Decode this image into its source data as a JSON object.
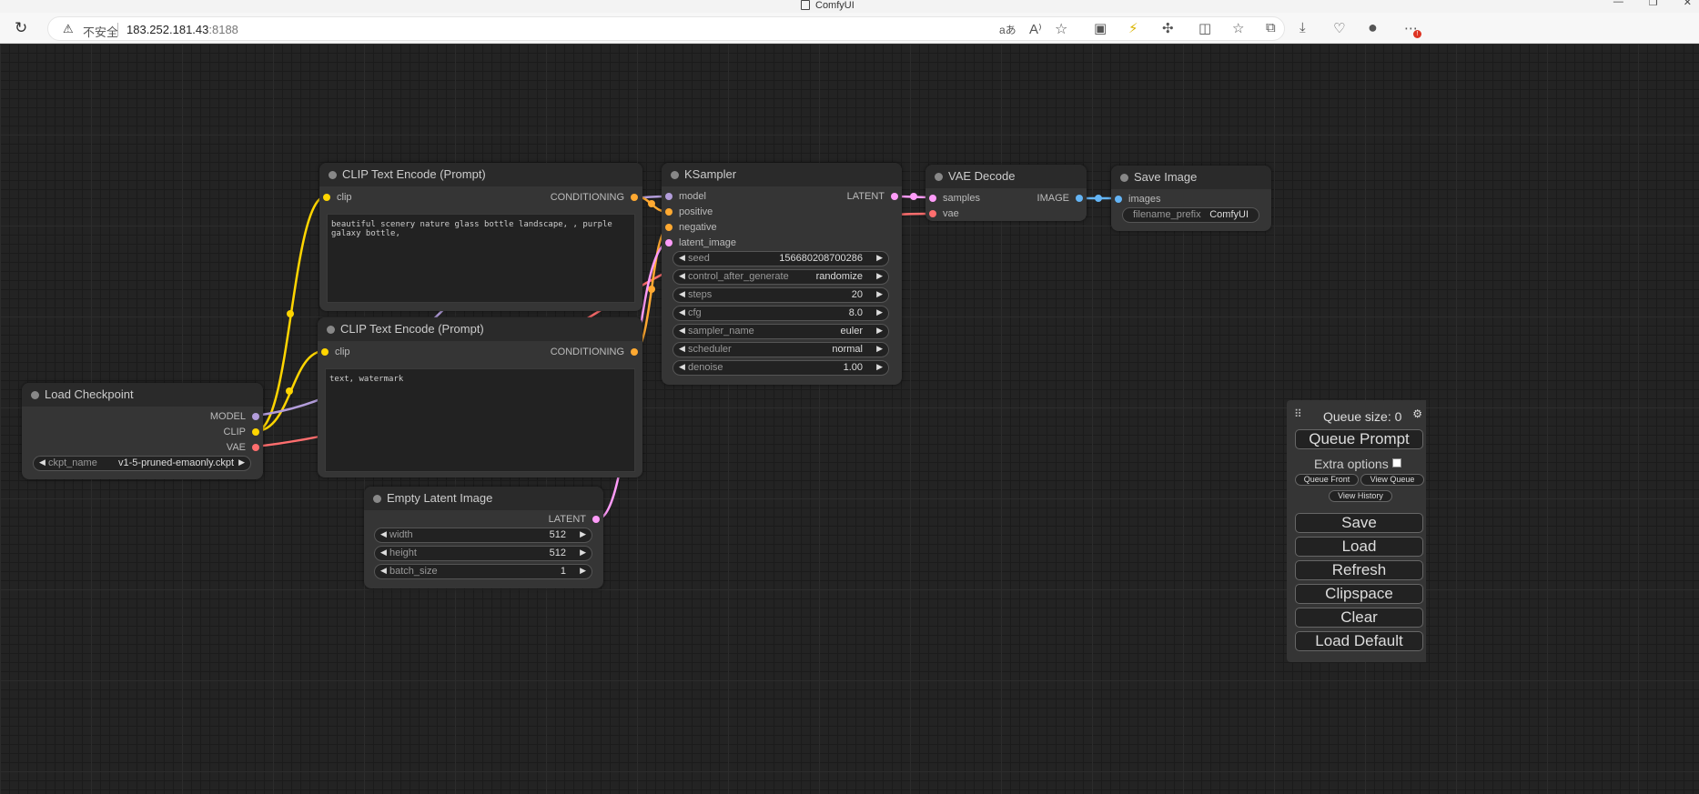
{
  "browser": {
    "tab_title": "ComfyUI",
    "insecure_label": "不安全",
    "host": "183.252.181.43",
    "port": ":8188",
    "window_buttons": [
      "—",
      "❐",
      "✕"
    ]
  },
  "colors": {
    "clip": "#ffd500",
    "conditioning": "#ffa931",
    "model": "#b39ddb",
    "latent": "#ff9cf9",
    "vae": "#ff6e6e",
    "image": "#64b5f6"
  },
  "nodes": {
    "clip_pos": {
      "title": "CLIP Text Encode (Prompt)",
      "input": "clip",
      "output": "CONDITIONING",
      "text": "beautiful scenery nature glass bottle landscape, , purple galaxy bottle,"
    },
    "clip_neg": {
      "title": "CLIP Text Encode (Prompt)",
      "input": "clip",
      "output": "CONDITIONING",
      "text": "text, watermark"
    },
    "checkpoint": {
      "title": "Load Checkpoint",
      "outputs": [
        "MODEL",
        "CLIP",
        "VAE"
      ],
      "widget_name": "ckpt_name",
      "widget_value": "v1-5-pruned-emaonly.ckpt"
    },
    "ksampler": {
      "title": "KSampler",
      "inputs": [
        "model",
        "positive",
        "negative",
        "latent_image"
      ],
      "output": "LATENT",
      "widgets": [
        {
          "name": "seed",
          "value": "156680208700286"
        },
        {
          "name": "control_after_generate",
          "value": "randomize"
        },
        {
          "name": "steps",
          "value": "20"
        },
        {
          "name": "cfg",
          "value": "8.0"
        },
        {
          "name": "sampler_name",
          "value": "euler"
        },
        {
          "name": "scheduler",
          "value": "normal"
        },
        {
          "name": "denoise",
          "value": "1.00"
        }
      ]
    },
    "vae_decode": {
      "title": "VAE Decode",
      "inputs": [
        "samples",
        "vae"
      ],
      "output": "IMAGE"
    },
    "save_image": {
      "title": "Save Image",
      "input": "images",
      "widget_name": "filename_prefix",
      "widget_value": "ComfyUI"
    },
    "empty_latent": {
      "title": "Empty Latent Image",
      "output": "LATENT",
      "widgets": [
        {
          "name": "width",
          "value": "512"
        },
        {
          "name": "height",
          "value": "512"
        },
        {
          "name": "batch_size",
          "value": "1"
        }
      ]
    }
  },
  "panel": {
    "queue_size": "Queue size: 0",
    "queue_prompt": "Queue Prompt",
    "extra_options": "Extra options",
    "queue_front": "Queue Front",
    "view_queue": "View Queue",
    "view_history": "View History",
    "buttons": [
      "Save",
      "Load",
      "Refresh",
      "Clipspace",
      "Clear",
      "Load Default"
    ]
  }
}
